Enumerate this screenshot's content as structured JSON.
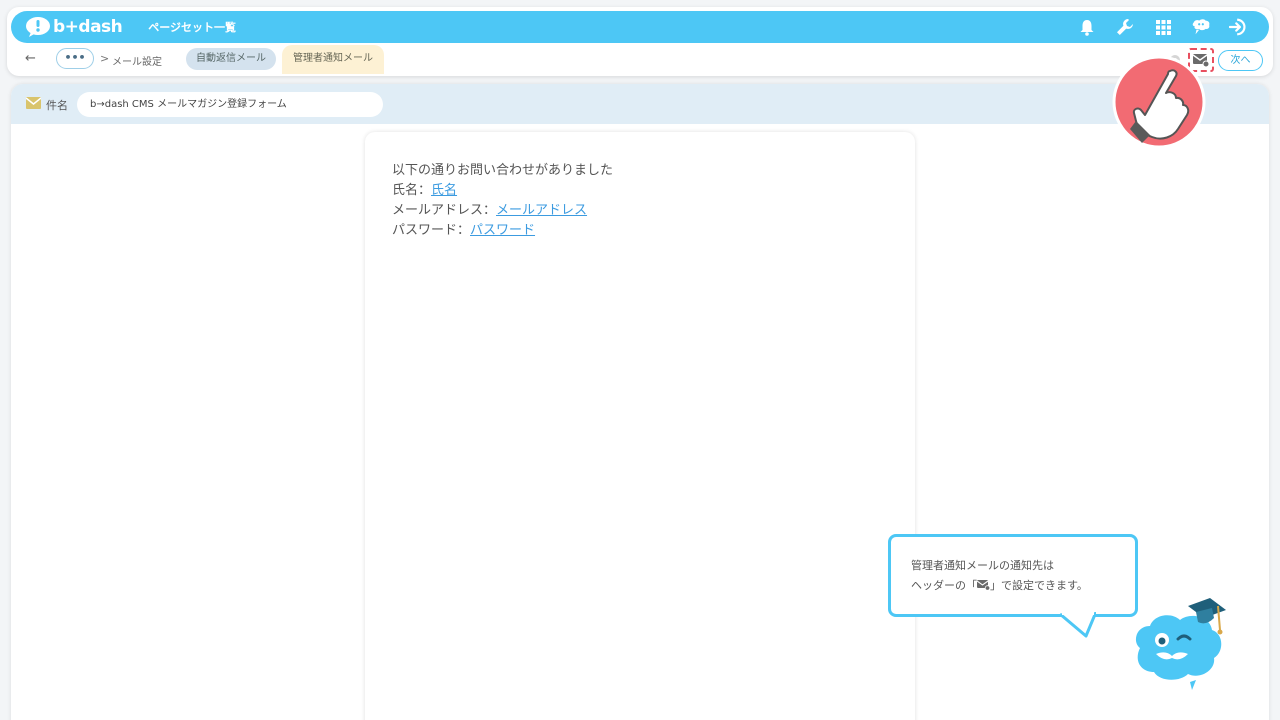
{
  "header": {
    "logo_text": "b+dash",
    "page_title": "ページセット一覧",
    "icons": [
      "bell-icon",
      "wrench-icon",
      "grid-icon",
      "brain-icon",
      "logout-icon"
    ]
  },
  "breadcrumb": {
    "back": "←",
    "more": "•••",
    "separator": ">",
    "mail_settings": "メール設定",
    "tab_auto_reply": "自動返信メール",
    "tab_admin_notify": "管理者通知メール",
    "next_button": "次へ"
  },
  "subject": {
    "label": "件名",
    "value": "b→dash CMS メールマガジン登録フォーム"
  },
  "mail_body": {
    "intro": "以下の通りお問い合わせがありました",
    "name_label": "氏名：",
    "name_link": "氏名",
    "email_label": "メールアドレス：",
    "email_link": "メールアドレス",
    "password_label": "パスワード：",
    "password_link": "パスワード"
  },
  "tooltip": {
    "line1": "管理者通知メールの通知先は",
    "line2_pre": "ヘッダーの「",
    "line2_post": "」で設定できます。"
  },
  "colors": {
    "brand": "#4dc7f5",
    "highlight": "#e84f5f",
    "link": "#3c9be0",
    "admin_tab": "#fdf1d4"
  }
}
